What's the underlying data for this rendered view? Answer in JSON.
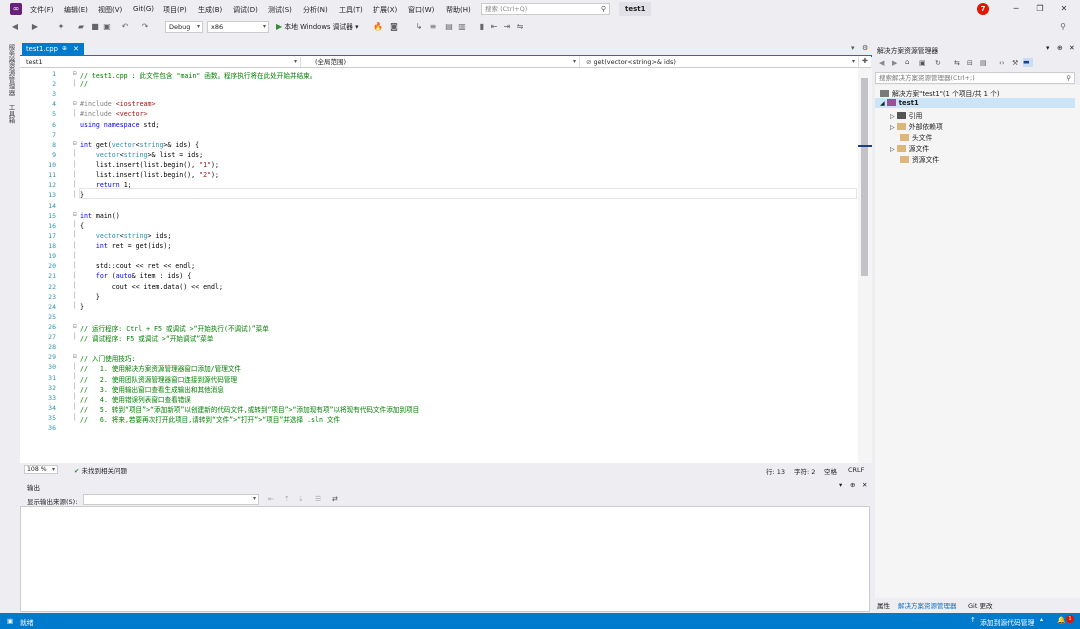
{
  "menu": {
    "items": [
      "文件(F)",
      "编辑(E)",
      "视图(V)",
      "Git(G)",
      "项目(P)",
      "生成(B)",
      "调试(D)",
      "测试(S)",
      "分析(N)",
      "工具(T)",
      "扩展(X)",
      "窗口(W)",
      "帮助(H)"
    ],
    "search_placeholder": "搜索 (Ctrl+Q)",
    "solution_name": "test1",
    "notification_count": "7"
  },
  "toolbar": {
    "config": "Debug",
    "platform": "x86",
    "run_label": "本地 Windows 调试器"
  },
  "left_tabs": [
    "服务器资源管理器",
    "工具箱"
  ],
  "document": {
    "tab_label": "test1.cpp",
    "nav_project": "test1",
    "nav_scope": "(全局范围)",
    "nav_member": "get(vector<string>& ids)"
  },
  "code_lines": [
    {
      "n": "1",
      "html": "<span class=\"cm\">// test1.cpp : 此文件包含 \"main\" 函数。程序执行将在此处开始并结束。</span>"
    },
    {
      "n": "2",
      "html": "<span class=\"cm\">//</span>"
    },
    {
      "n": "3",
      "html": ""
    },
    {
      "n": "4",
      "html": "<span class=\"pp\">#include</span> <span class=\"str\">&lt;iostream&gt;</span>"
    },
    {
      "n": "5",
      "html": "<span class=\"pp\">#include</span> <span class=\"str\">&lt;vector&gt;</span>"
    },
    {
      "n": "6",
      "html": "<span class=\"kw\">using namespace</span> std;"
    },
    {
      "n": "7",
      "html": ""
    },
    {
      "n": "8",
      "html": "<span class=\"kw\">int</span> get(<span class=\"ty\">vector</span>&lt;<span class=\"ty\">string</span>&gt;&amp; ids) {"
    },
    {
      "n": "9",
      "html": "    <span class=\"ty\">vector</span>&lt;<span class=\"ty\">string</span>&gt;&amp; list = ids;"
    },
    {
      "n": "10",
      "html": "    list.insert(list.begin(), <span class=\"str\">\"1\"</span>);"
    },
    {
      "n": "11",
      "html": "    list.insert(list.begin(), <span class=\"str\">\"2\"</span>);"
    },
    {
      "n": "12",
      "html": "    <span class=\"kw\">return</span> 1;"
    },
    {
      "n": "13",
      "html": "}"
    },
    {
      "n": "14",
      "html": ""
    },
    {
      "n": "15",
      "html": "<span class=\"kw\">int</span> main()"
    },
    {
      "n": "16",
      "html": "{"
    },
    {
      "n": "17",
      "html": "    <span class=\"ty\">vector</span>&lt;<span class=\"ty\">string</span>&gt; ids;"
    },
    {
      "n": "18",
      "html": "    <span class=\"kw\">int</span> ret = get(ids);"
    },
    {
      "n": "19",
      "html": ""
    },
    {
      "n": "20",
      "html": "    std::cout &lt;&lt; ret &lt;&lt; endl;"
    },
    {
      "n": "21",
      "html": "    <span class=\"kw\">for</span> (<span class=\"kw\">auto</span>&amp; item : ids) {"
    },
    {
      "n": "22",
      "html": "        cout &lt;&lt; item.data() &lt;&lt; endl;"
    },
    {
      "n": "23",
      "html": "    }"
    },
    {
      "n": "24",
      "html": "}"
    },
    {
      "n": "25",
      "html": ""
    },
    {
      "n": "26",
      "html": "<span class=\"cm\">// 运行程序: Ctrl + F5 或调试 &gt;“开始执行(不调试)”菜单</span>"
    },
    {
      "n": "27",
      "html": "<span class=\"cm\">// 调试程序: F5 或调试 &gt;“开始调试”菜单</span>"
    },
    {
      "n": "28",
      "html": ""
    },
    {
      "n": "29",
      "html": "<span class=\"cm\">// 入门使用技巧:</span>"
    },
    {
      "n": "30",
      "html": "<span class=\"cm\">//   1. 使用解决方案资源管理器窗口添加/管理文件</span>"
    },
    {
      "n": "31",
      "html": "<span class=\"cm\">//   2. 使用团队资源管理器窗口连接到源代码管理</span>"
    },
    {
      "n": "32",
      "html": "<span class=\"cm\">//   3. 使用输出窗口查看生成输出和其他消息</span>"
    },
    {
      "n": "33",
      "html": "<span class=\"cm\">//   4. 使用错误列表窗口查看错误</span>"
    },
    {
      "n": "34",
      "html": "<span class=\"cm\">//   5. 转到“项目”&gt;“添加新项”以创建新的代码文件,或转到“项目”&gt;“添加现有项”以将现有代码文件添加到项目</span>"
    },
    {
      "n": "35",
      "html": "<span class=\"cm\">//   6. 将来,若要再次打开此项目,请转到“文件”&gt;“打开”&gt;“项目”并选择 .sln 文件</span>"
    },
    {
      "n": "36",
      "html": ""
    }
  ],
  "editor_status": {
    "zoom": "108 %",
    "issues": "未找到相关问题",
    "line": "行: 13",
    "char": "字符: 2",
    "whitespace": "空格",
    "eol": "CRLF"
  },
  "output": {
    "title": "输出",
    "source_label": "显示输出来源(S):"
  },
  "solution_explorer": {
    "title": "解决方案资源管理器",
    "search_placeholder": "搜索解决方案资源管理器(Ctrl+;)",
    "solution_node": "解决方案\"test1\"(1 个项目/共 1 个)",
    "project_node": "test1",
    "children": [
      "引用",
      "外部依赖项",
      "头文件",
      "源文件",
      "资源文件"
    ],
    "tabs": [
      "属性",
      "解决方案资源管理器",
      "Git 更改"
    ]
  },
  "statusbar": {
    "ready": "就绪",
    "source_control": "添加到源代码管理",
    "bell_count": "1"
  }
}
